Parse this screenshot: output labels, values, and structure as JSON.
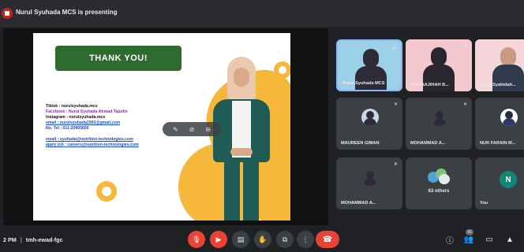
{
  "header": {
    "presenting_text": "Nurul Syuhada MCS is presenting"
  },
  "slide": {
    "title": "THANK YOU!",
    "contact_lines": [
      {
        "text": "Tiktok : nurulsyuhada.mcs",
        "style": "dark"
      },
      {
        "text": "Facebook : Nurul Syuhada Ahmad Tajudin",
        "style": "purple"
      },
      {
        "text": "Instagram : nurulsyuhada.mcs",
        "style": "dark"
      },
      {
        "text": "email : nurulsyuhada1993@gmail.com",
        "style": "link"
      },
      {
        "text": "No. Tel : 011-20905600",
        "style": "blue"
      }
    ],
    "contact_lines_2": [
      {
        "text": "email : syuhada@nutrition-technologies.com",
        "style": "link"
      },
      {
        "text": "apply job : careers@nutrition-technologies.com",
        "style": "link"
      }
    ],
    "accent_color": "#f5b83a",
    "title_bg_color": "#2f6a30"
  },
  "participants": [
    {
      "name": "Nurul Syuhada MCS",
      "type": "camera",
      "muted": false
    },
    {
      "name": "NUR NAJIHAH B...",
      "type": "camera",
      "muted": true
    },
    {
      "name": "Nurul Syahidah...",
      "type": "camera",
      "muted": true
    },
    {
      "name": "MAUREEN GIMAN",
      "type": "avatar",
      "muted": true
    },
    {
      "name": "MOHAMMAD A...",
      "type": "avatar",
      "muted": true
    },
    {
      "name": "NUR FARAIN M...",
      "type": "avatar",
      "muted": true
    },
    {
      "name": "MOHAMMAD A...",
      "type": "avatar",
      "muted": true
    },
    {
      "name": "63 others",
      "type": "others",
      "muted": false
    },
    {
      "name": "You",
      "type": "letter",
      "letter": "N",
      "muted": false
    }
  ],
  "footer": {
    "time": "2 PM",
    "meeting_code": "tmh-ewad-fgc",
    "controls": [
      "mic-off-icon",
      "camera-off-icon",
      "captions-icon",
      "raise-hand-icon",
      "present-icon",
      "more-icon"
    ],
    "right_icons": [
      "info-icon",
      "people-icon",
      "chat-icon",
      "activities-icon"
    ],
    "people_count": "66"
  }
}
